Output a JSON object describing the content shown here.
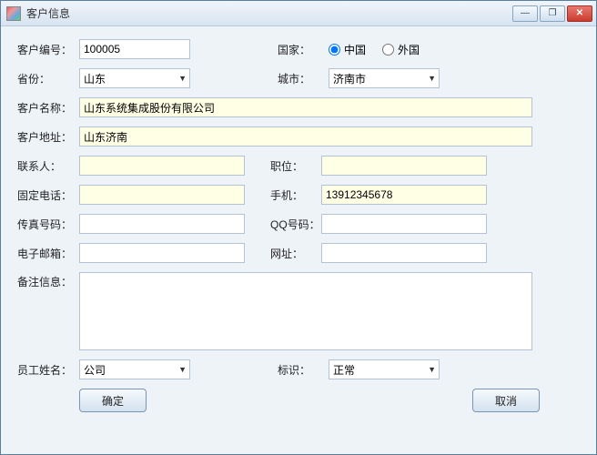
{
  "window": {
    "title": "客户信息"
  },
  "winbuttons": {
    "min": "—",
    "max": "❐",
    "close": "✕"
  },
  "labels": {
    "customer_id": "客户编号：",
    "country": "国家：",
    "province": "省份：",
    "city": "城市：",
    "customer_name": "客户名称：",
    "customer_addr": "客户地址：",
    "contact": "联系人：",
    "position": "职位：",
    "tel": "固定电话：",
    "mobile": "手机：",
    "fax": "传真号码：",
    "qq": "QQ号码：",
    "email": "电子邮箱：",
    "website": "网址：",
    "remarks": "备注信息：",
    "employee": "员工姓名：",
    "flag": "标识："
  },
  "values": {
    "customer_id": "100005",
    "province": "山东",
    "city": "济南市",
    "customer_name": "山东系统集成股份有限公司",
    "customer_addr": "山东济南",
    "contact": "",
    "position": "",
    "tel": "",
    "mobile": "13912345678",
    "fax": "",
    "qq": "",
    "email": "",
    "website": "",
    "remarks": "",
    "employee": "公司",
    "flag": "正常"
  },
  "country": {
    "opt_cn": "中国",
    "opt_foreign": "外国",
    "selected": "中国"
  },
  "buttons": {
    "ok": "确定",
    "cancel": "取消"
  }
}
